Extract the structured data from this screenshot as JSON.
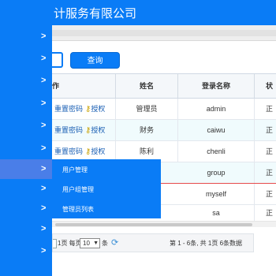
{
  "header": {
    "company": "计服务有限公司"
  },
  "sidebar": {
    "chevrons": [
      ">",
      ">",
      ">",
      ">",
      ">",
      ">",
      ">",
      ">",
      ">",
      ">",
      ">"
    ]
  },
  "search": {
    "value": "",
    "button_label": "查询"
  },
  "grid": {
    "columns": [
      "作",
      "姓名",
      "登录名称",
      "状"
    ],
    "rows": [
      {
        "ops": [
          "重置密码",
          "授权"
        ],
        "name": "管理员",
        "login": "admin",
        "status": "正"
      },
      {
        "ops": [
          "重置密码",
          "授权"
        ],
        "name": "财务",
        "login": "caiwu",
        "status": "正"
      },
      {
        "ops": [
          "重置密码",
          "授权"
        ],
        "name": "陈利",
        "login": "chenli",
        "status": "正"
      },
      {
        "ops": [],
        "name": "",
        "login": "group",
        "status": "正"
      },
      {
        "ops": [],
        "name": "",
        "login": "myself",
        "status": "正"
      },
      {
        "ops": [],
        "name": "",
        "login": "sa",
        "status": "正"
      }
    ]
  },
  "pager": {
    "prefix": "1页 每页",
    "page_size": "10",
    "suffix": "条",
    "summary": "第 1 - 6条, 共 1页 6条数据"
  },
  "flyout": {
    "items": [
      "用户管理",
      "用户组管理",
      "管理员列表"
    ]
  },
  "colors": {
    "brand": "#0a7cf6",
    "active": "#4a7ee8",
    "link": "#1a5fb4",
    "selected_row_border": "#e64a4a"
  },
  "icons": {
    "key": "key-icon",
    "refresh": "refresh-icon",
    "chevron": "chevron-right-icon"
  }
}
